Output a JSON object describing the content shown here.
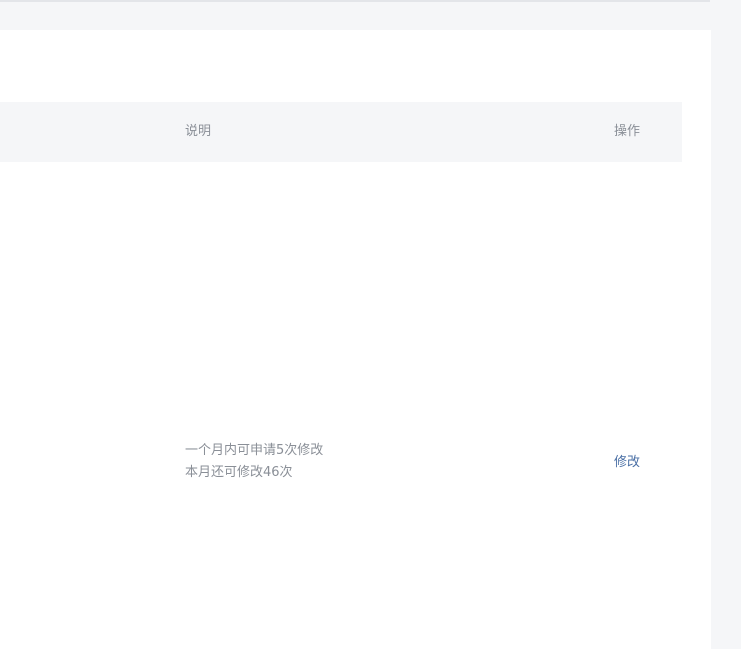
{
  "table": {
    "headers": {
      "description": "说明",
      "actions": "操作"
    },
    "rows": [
      {
        "description_lines": [
          "一个月内可申请5次修改",
          "本月还可修改46次"
        ],
        "action_label": "修改"
      }
    ]
  },
  "colors": {
    "page_background": "#f5f6f8",
    "panel_background": "#ffffff",
    "header_background": "#f5f6f8",
    "muted_text": "#8a8f97",
    "link": "#4a6fa5"
  }
}
